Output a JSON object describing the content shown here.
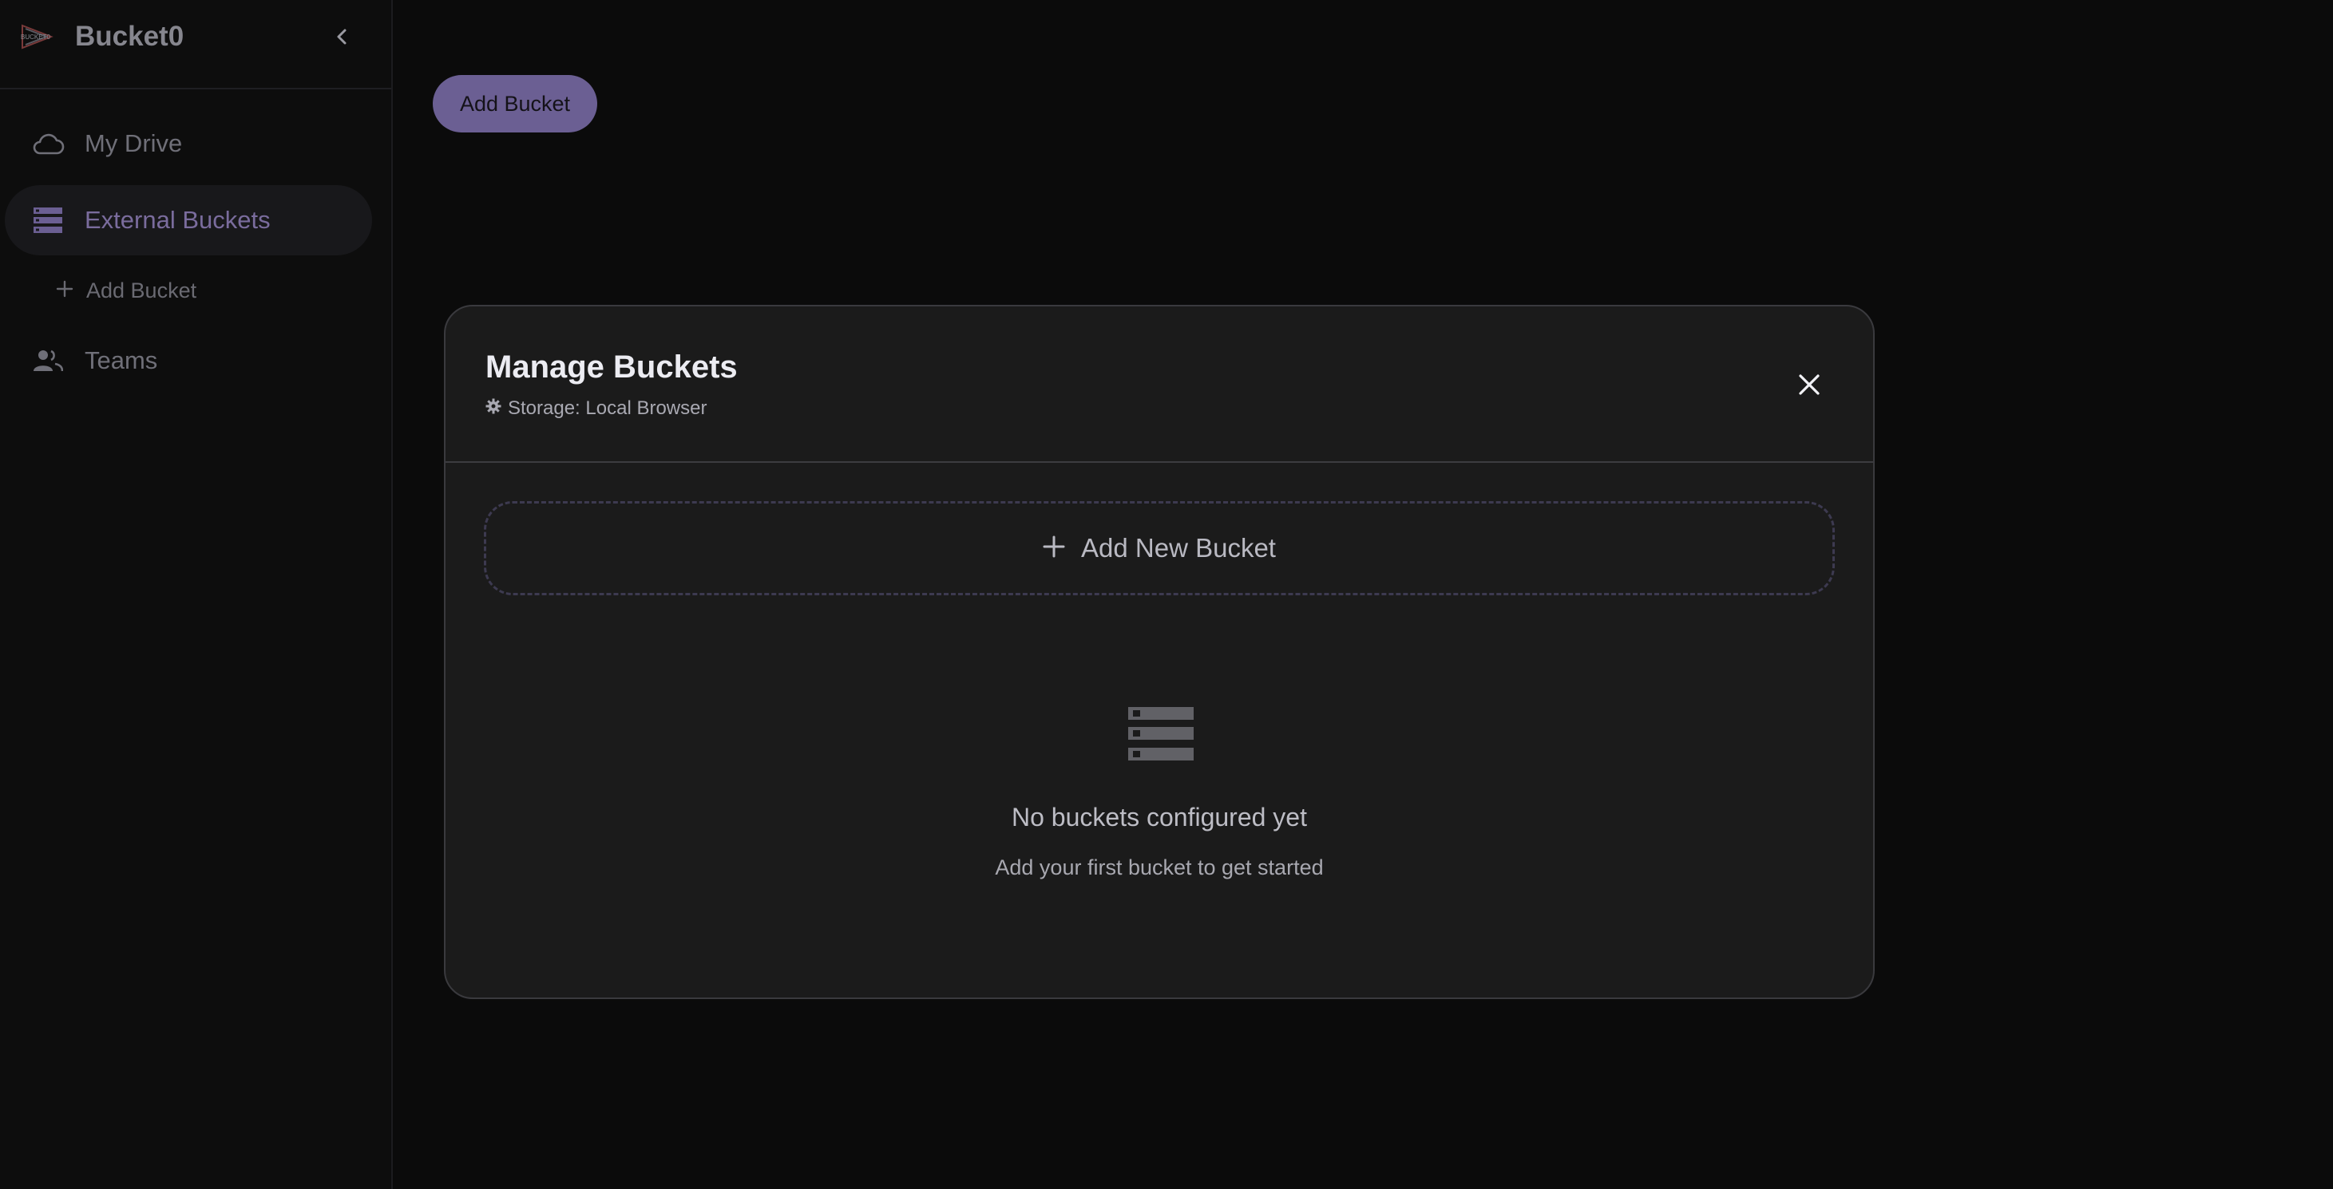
{
  "sidebar": {
    "brand": "Bucket0",
    "logo_text": "BUCKET0",
    "items": [
      {
        "label": "My Drive",
        "icon": "cloud-icon"
      },
      {
        "label": "External Buckets",
        "icon": "server-icon",
        "active": true
      },
      {
        "label": "Add Bucket",
        "icon": "plus-icon"
      },
      {
        "label": "Teams",
        "icon": "people-icon"
      }
    ]
  },
  "toolbar": {
    "add_bucket_label": "Add Bucket"
  },
  "modal": {
    "title": "Manage Buckets",
    "storage_label": "Storage: Local Browser",
    "add_new_label": "Add New Bucket",
    "empty_title": "No buckets configured yet",
    "empty_subtitle": "Add your first bucket to get started"
  },
  "colors": {
    "accent": "#6b5f93",
    "active_text": "#7a6c9d",
    "background": "#0b0b0b",
    "modal_bg": "#1b1b1b"
  }
}
